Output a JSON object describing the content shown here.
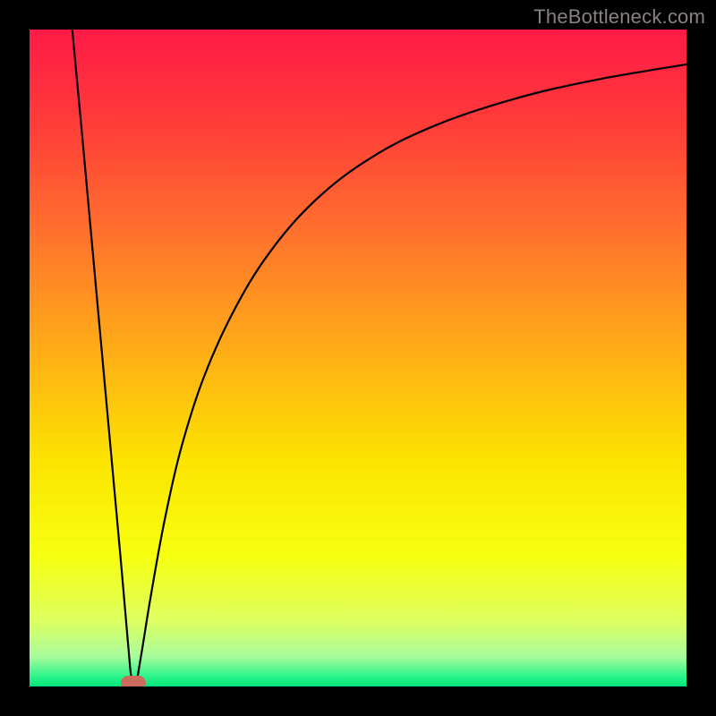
{
  "watermark": "TheBottleneck.com",
  "marker_color": "#cc6c5d",
  "chart_data": {
    "type": "line",
    "title": "",
    "xlabel": "",
    "ylabel": "",
    "xlim": [
      0,
      100
    ],
    "ylim": [
      0,
      100
    ],
    "background_gradient_stops": [
      {
        "offset": 0.0,
        "color": "#ff1a46"
      },
      {
        "offset": 0.14,
        "color": "#ff3b39"
      },
      {
        "offset": 0.3,
        "color": "#ff6e2e"
      },
      {
        "offset": 0.48,
        "color": "#ffaa18"
      },
      {
        "offset": 0.66,
        "color": "#fce500"
      },
      {
        "offset": 0.8,
        "color": "#f7ff0f"
      },
      {
        "offset": 0.9,
        "color": "#deff60"
      },
      {
        "offset": 0.955,
        "color": "#a8fc9d"
      },
      {
        "offset": 0.985,
        "color": "#2bf58c"
      },
      {
        "offset": 1.0,
        "color": "#00e67a"
      }
    ],
    "series": [
      {
        "name": "left-branch",
        "x": [
          6.5,
          8.0,
          10.0,
          12.0,
          14.0,
          15.3,
          15.8
        ],
        "y": [
          100,
          84,
          62,
          40,
          18,
          3,
          0
        ]
      },
      {
        "name": "right-branch",
        "x": [
          16.2,
          17.2,
          18.5,
          20.5,
          23.0,
          26.5,
          31.0,
          36.5,
          43.5,
          52.0,
          62.0,
          74.0,
          86.0,
          100.0
        ],
        "y": [
          0,
          6,
          14,
          25,
          36,
          47,
          57,
          66,
          74,
          80.5,
          85.5,
          89.5,
          92.3,
          94.7
        ]
      }
    ],
    "annotations": [
      {
        "name": "minimum-marker",
        "x": 15.8,
        "y": 0.5
      }
    ]
  }
}
